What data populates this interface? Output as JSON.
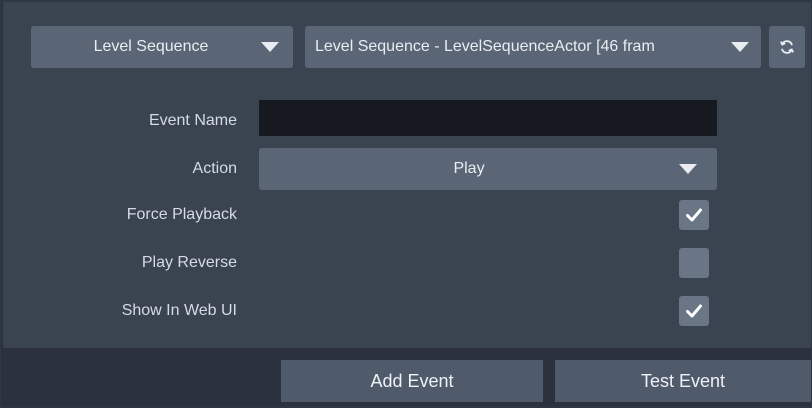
{
  "toolbar": {
    "sequence_type": "Level Sequence",
    "sequence_asset": "Level Sequence - LevelSequenceActor [46 fram",
    "refresh_icon": "refresh-icon"
  },
  "form": {
    "event_name": {
      "label": "Event Name",
      "value": ""
    },
    "action": {
      "label": "Action",
      "value": "Play"
    },
    "force_playback": {
      "label": "Force Playback",
      "checked": true
    },
    "play_reverse": {
      "label": "Play Reverse",
      "checked": false
    },
    "show_in_web_ui": {
      "label": "Show In Web UI",
      "checked": true
    }
  },
  "footer": {
    "add_event": "Add Event",
    "test_event": "Test Event"
  },
  "colors": {
    "background": "#3a4350",
    "control": "#5a6576",
    "input": "#161a20",
    "footer": "#2b323d",
    "button": "#4f5a6b"
  }
}
